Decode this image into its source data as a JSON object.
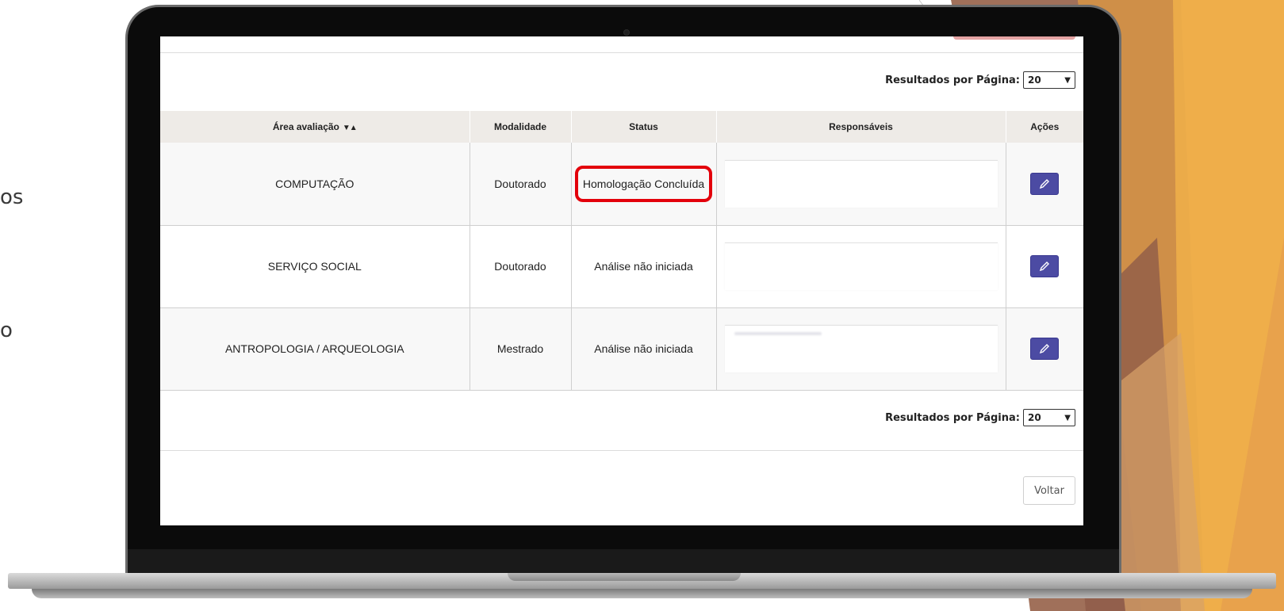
{
  "side_text": {
    "line1": "os",
    "line2": "o"
  },
  "pagination": {
    "label": "Resultados por Página:",
    "value": "20"
  },
  "table": {
    "headers": {
      "area": "Área avaliação",
      "sort_glyph": "▼▲",
      "modalidade": "Modalidade",
      "status": "Status",
      "responsaveis": "Responsáveis",
      "acoes": "Ações"
    },
    "rows": [
      {
        "area": "COMPUTAÇÃO",
        "modalidade": "Doutorado",
        "status": "Homologação Concluída",
        "highlighted": true
      },
      {
        "area": "SERVIÇO SOCIAL",
        "modalidade": "Doutorado",
        "status": "Análise não iniciada",
        "highlighted": false
      },
      {
        "area": "ANTROPOLOGIA / ARQUEOLOGIA",
        "modalidade": "Mestrado",
        "status": "Análise não iniciada",
        "highlighted": false
      }
    ]
  },
  "footer": {
    "back_label": "Voltar"
  },
  "icons": {
    "edit": "pencil-icon",
    "dropdown": "chevron-down-icon"
  },
  "colors": {
    "edit_button": "#4c4ba3",
    "highlight": "#e3000b",
    "header_bg": "#eeebe7"
  }
}
